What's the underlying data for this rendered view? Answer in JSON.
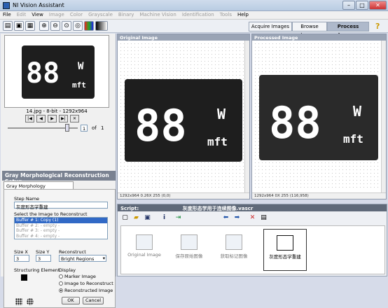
{
  "window": {
    "title": "NI Vision Assistant"
  },
  "menu": [
    "File",
    "Edit",
    "View",
    "Image",
    "Color",
    "Grayscale",
    "Binary",
    "Machine Vision",
    "Identification",
    "Tools",
    "Help"
  ],
  "mode_tabs": [
    "Acquire Images",
    "Browse Images",
    "Process Images"
  ],
  "thumbnail": {
    "info": "14.jpg - 8-bit - 1292x964",
    "page": "1",
    "of_label": "of",
    "total": "1",
    "digits": "88",
    "unit_top": "W",
    "unit_bottom": "mft",
    "slider_fraction": 0.85
  },
  "setup": {
    "header": "Gray Morphological Reconstruction Setup",
    "subtab": "Gray Morphology Reconstruction",
    "step_name_label": "Step Name",
    "step_name_value": "灰度形态学重建",
    "select_label": "Select the Image to Reconstruct",
    "buffers": [
      "Buffer # 1:  Copy (1)",
      "Buffer # 2:  - empty -",
      "Buffer # 3:  - empty -",
      "Buffer # 4:  - empty -"
    ],
    "size_x_label": "Size X",
    "size_x": "3",
    "size_y_label": "Size Y",
    "size_y": "3",
    "reconstruct_label": "Reconstruct",
    "reconstruct_value": "Bright Regions",
    "structuring_label": "Structuring Element",
    "display_label": "Display",
    "display_options": [
      "Marker Image",
      "Image to Reconstruct",
      "Reconstructed Image"
    ],
    "ok": "OK",
    "cancel": "Cancel"
  },
  "original": {
    "title": "Original Image",
    "footer": "1292x964 0.26X 255   (0,0)"
  },
  "processed": {
    "title": "Processed Image",
    "footer": "1292x964 0X 255   (116,958)"
  },
  "script": {
    "label": "Script:",
    "name": "灰度形态学用于连续图像.vascr",
    "steps": [
      "Original Image",
      "保存原始图像",
      "获取标记图像",
      "灰度形态学重建"
    ]
  },
  "colors": {
    "accent": "#3169c6",
    "header": "#7a8291"
  }
}
